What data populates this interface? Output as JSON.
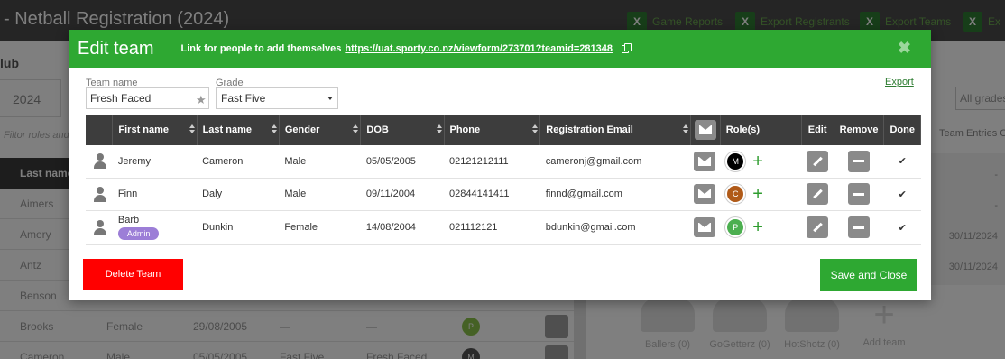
{
  "background": {
    "page_title": "- Netball Registration (2024)",
    "toolbar": [
      {
        "label": "Game Reports"
      },
      {
        "label": "Export Registrants"
      },
      {
        "label": "Export Teams"
      },
      {
        "label": "Ex"
      }
    ],
    "club_label": "lub",
    "year": "2024",
    "filter_placeholder": "Filtor roles and",
    "all_grades": "All grades",
    "team_entries": "Team Entries C",
    "list_header": "Last name",
    "rows": [
      {
        "last": "Aimers",
        "gender": "",
        "dob": "",
        "grade": "",
        "team": ""
      },
      {
        "last": "Amery",
        "gender": "",
        "dob": "",
        "grade": "",
        "team": ""
      },
      {
        "last": "Antz",
        "gender": "",
        "dob": "",
        "grade": "",
        "team": ""
      },
      {
        "last": "Benson",
        "gender": "",
        "dob": "",
        "grade": "",
        "team": ""
      },
      {
        "last": "Brooks",
        "gender": "Female",
        "dob": "29/08/2005",
        "grade": "—",
        "team": "—",
        "role": "P"
      },
      {
        "last": "Cameron",
        "gender": "Male",
        "dob": "05/05/2005",
        "grade": "Fast Five",
        "team": "Fresh Faced",
        "role": "M"
      }
    ],
    "right_values": [
      "-",
      "-",
      "30/11/2024",
      "30/11/2024"
    ],
    "teams": [
      {
        "label": "Ballers (0)"
      },
      {
        "label": "GoGetterz (0)"
      },
      {
        "label": "HotShotz (0)"
      },
      {
        "label": "Add team"
      }
    ]
  },
  "modal": {
    "title": "Edit team",
    "link_text": "Link for people to add themselves",
    "link_url": "https://uat.sporty.co.nz/viewform/273701?teamid=281348",
    "close_symbol": "✖",
    "team_name_label": "Team name",
    "team_name_value": "Fresh Faced",
    "grade_label": "Grade",
    "grade_value": "Fast Five",
    "export_label": "Export",
    "columns": {
      "first_name": "First name",
      "last_name": "Last name",
      "gender": "Gender",
      "dob": "DOB",
      "phone": "Phone",
      "email": "Registration Email",
      "roles": "Role(s)",
      "edit": "Edit",
      "remove": "Remove",
      "done": "Done"
    },
    "members": [
      {
        "first": "Jeremy",
        "badge": "",
        "last": "Cameron",
        "gender": "Male",
        "dob": "05/05/2005",
        "phone": "02121212111",
        "email": "cameronj@gmail.com",
        "role_letter": "M",
        "role_color": "#000000"
      },
      {
        "first": "Finn",
        "badge": "",
        "last": "Daly",
        "gender": "Male",
        "dob": "09/11/2004",
        "phone": "02844141411",
        "email": "finnd@gmail.com",
        "role_letter": "C",
        "role_color": "#b05a18"
      },
      {
        "first": "Barb",
        "badge": "Admin",
        "last": "Dunkin",
        "gender": "Female",
        "dob": "14/08/2004",
        "phone": "021112121",
        "email": "bdunkin@gmail.com",
        "role_letter": "P",
        "role_color": "#4caf50"
      }
    ],
    "delete_label": "Delete Team",
    "save_label": "Save and Close"
  }
}
